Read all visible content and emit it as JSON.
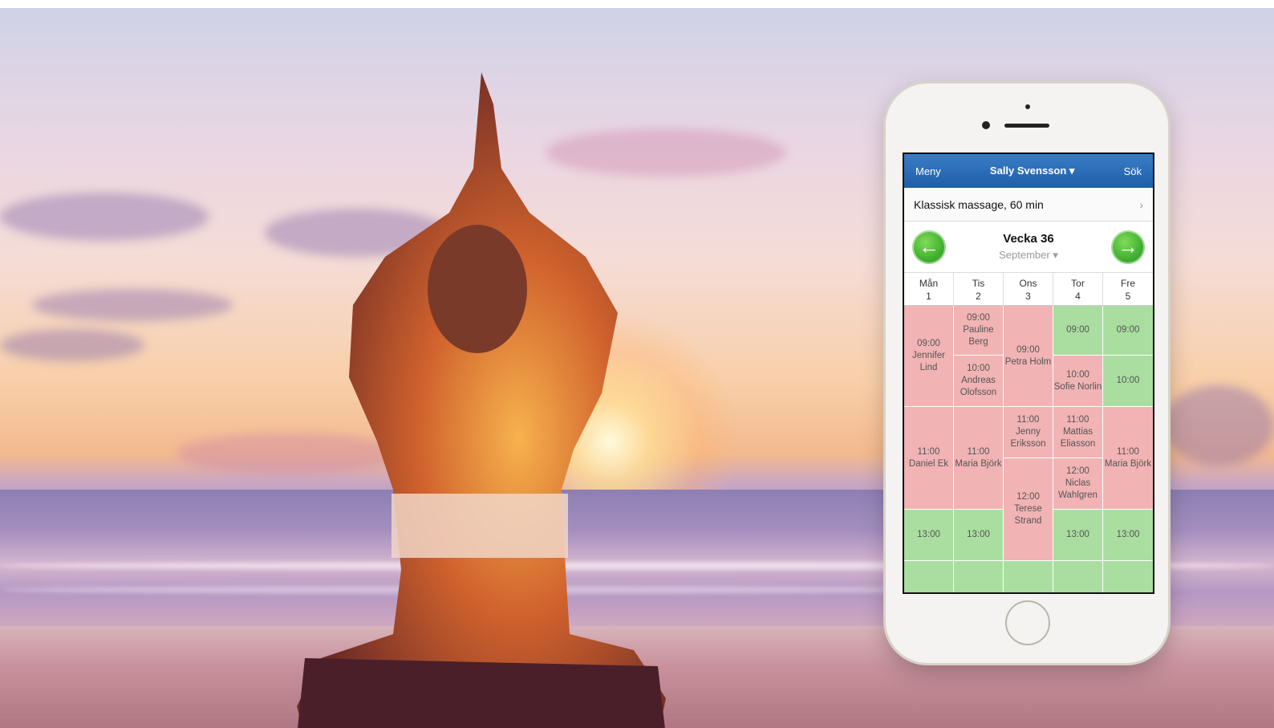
{
  "app": {
    "navbar": {
      "menu_label": "Meny",
      "user_label": "Sally Svensson ▾",
      "search_label": "Sök"
    },
    "service": {
      "label": "Klassisk massage, 60 min",
      "chevron": "›"
    },
    "week": {
      "title": "Vecka 36",
      "month": "September ▾",
      "prev_icon": "arrow-left-icon",
      "next_icon": "arrow-right-icon"
    },
    "days": [
      {
        "name": "Mån",
        "date": "1"
      },
      {
        "name": "Tis",
        "date": "2"
      },
      {
        "name": "Ons",
        "date": "3"
      },
      {
        "name": "Tor",
        "date": "4"
      },
      {
        "name": "Fre",
        "date": "5"
      }
    ],
    "slots": {
      "mon": [
        {
          "time": "09:00",
          "name": "Jennifer Lind",
          "status": "busy"
        },
        {
          "time": "11:00",
          "name": "Daniel Ek",
          "status": "busy"
        },
        {
          "time": "13:00",
          "name": "",
          "status": "free"
        },
        {
          "time": "",
          "name": "",
          "status": "free"
        }
      ],
      "tue": [
        {
          "time": "09:00",
          "name": "Pauline Berg",
          "status": "busy"
        },
        {
          "time": "10:00",
          "name": "Andreas Olofsson",
          "status": "busy"
        },
        {
          "time": "11:00",
          "name": "Maria Björk",
          "status": "busy"
        },
        {
          "time": "13:00",
          "name": "",
          "status": "free"
        },
        {
          "time": "",
          "name": "",
          "status": "free"
        }
      ],
      "wed": [
        {
          "time": "09:00",
          "name": "Petra Holm",
          "status": "busy"
        },
        {
          "time": "11:00",
          "name": "Jenny Eriksson",
          "status": "busy"
        },
        {
          "time": "12:00",
          "name": "Terese Strand",
          "status": "busy"
        },
        {
          "time": "",
          "name": "",
          "status": "free"
        }
      ],
      "thu": [
        {
          "time": "09:00",
          "name": "",
          "status": "free"
        },
        {
          "time": "10:00",
          "name": "Sofie Norlin",
          "status": "busy"
        },
        {
          "time": "11:00",
          "name": "Mattias Eliasson",
          "status": "busy"
        },
        {
          "time": "12:00",
          "name": "Niclas Wahlgren",
          "status": "busy"
        },
        {
          "time": "13:00",
          "name": "",
          "status": "free"
        },
        {
          "time": "",
          "name": "",
          "status": "free"
        }
      ],
      "fri": [
        {
          "time": "09:00",
          "name": "",
          "status": "free"
        },
        {
          "time": "10:00",
          "name": "",
          "status": "free"
        },
        {
          "time": "11:00",
          "name": "Maria Björk",
          "status": "busy"
        },
        {
          "time": "13:00",
          "name": "",
          "status": "free"
        },
        {
          "time": "",
          "name": "",
          "status": "free"
        }
      ]
    }
  },
  "colors": {
    "busy": "#f1b3b4",
    "free": "#a9dea0",
    "nav": "#1f5ea8"
  }
}
